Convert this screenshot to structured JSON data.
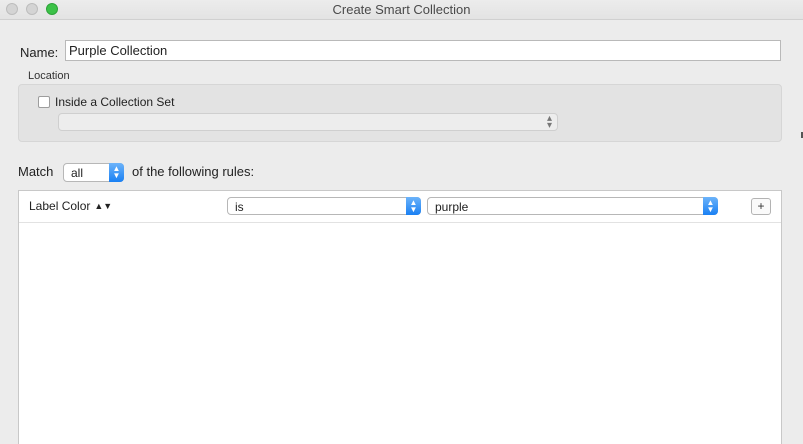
{
  "window": {
    "title": "Create Smart Collection"
  },
  "name_row": {
    "label": "Name:",
    "value": "Purple Collection"
  },
  "location": {
    "legend": "Location",
    "checkbox_label": "Inside a Collection Set",
    "checkbox_checked": false,
    "collection_set_value": ""
  },
  "match_row": {
    "prefix": "Match",
    "mode": "all",
    "suffix": "of the following rules:"
  },
  "rules": [
    {
      "field": "Label Color",
      "operator": "is",
      "value": "purple"
    }
  ],
  "add_rule_label": "+",
  "colors": {
    "accent": "#1a80f3",
    "maximize_button": "#3cc248"
  }
}
